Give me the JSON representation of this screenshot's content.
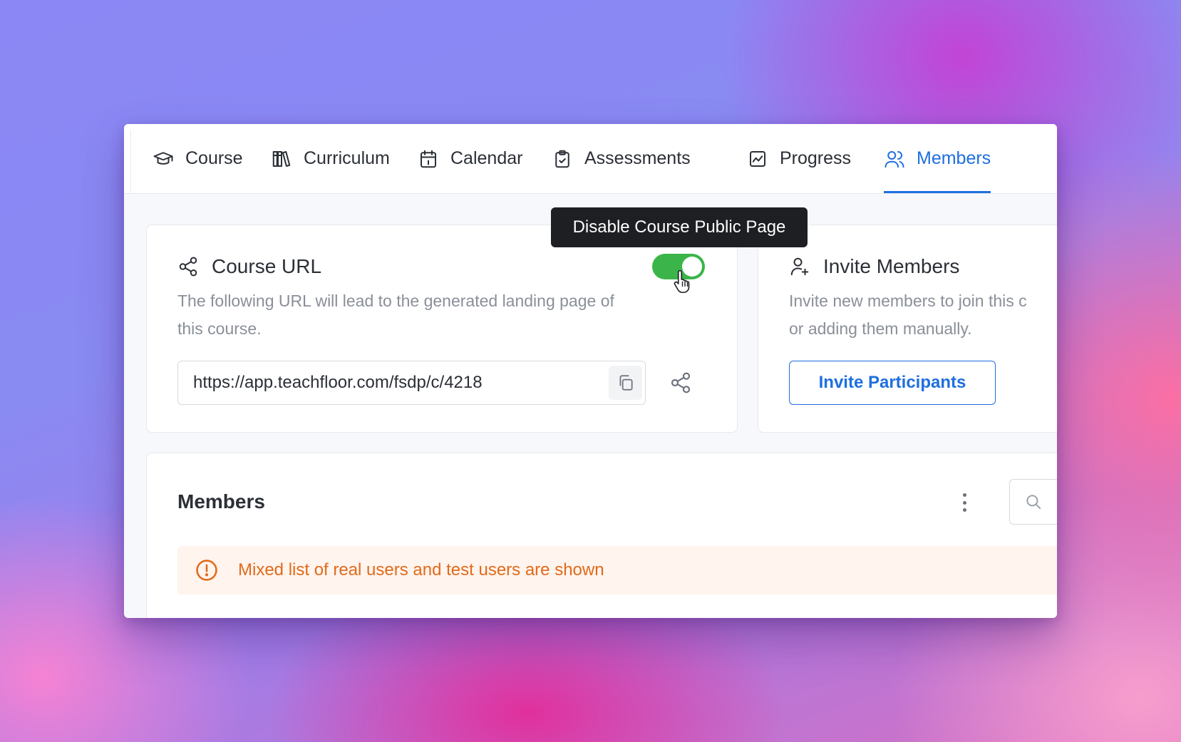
{
  "tabs": [
    {
      "label": "Course",
      "icon": "graduation-cap-icon",
      "active": false
    },
    {
      "label": "Curriculum",
      "icon": "books-icon",
      "active": false
    },
    {
      "label": "Calendar",
      "icon": "calendar-icon",
      "active": false
    },
    {
      "label": "Assessments",
      "icon": "clipboard-check-icon",
      "active": false
    },
    {
      "label": "Progress",
      "icon": "chart-line-icon",
      "active": false
    },
    {
      "label": "Members",
      "icon": "users-icon",
      "active": true
    }
  ],
  "tooltip": "Disable Course Public Page",
  "course_url": {
    "title": "Course URL",
    "description_line1": "The following URL will lead to the generated landing page of",
    "description_line2": "this course.",
    "url": "https://app.teachfloor.com/fsdp/c/4218",
    "public_page_enabled": true
  },
  "invite": {
    "title": "Invite Members",
    "description_line1": "Invite new members to join this c",
    "description_line2": "or adding them manually.",
    "button_label": "Invite Participants"
  },
  "members": {
    "title": "Members",
    "alert": "Mixed list of real users and test users are shown"
  },
  "colors": {
    "accent": "#1f6fe0",
    "toggle_on": "#3bb54a",
    "warning": "#e16a1a",
    "warning_bg": "#fff4ee"
  }
}
